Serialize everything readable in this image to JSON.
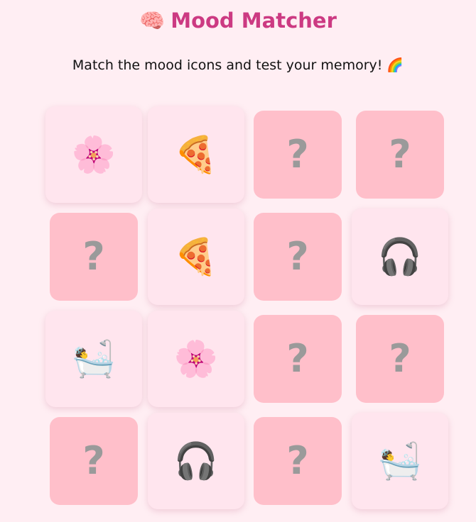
{
  "header": {
    "title_emoji": "🧠",
    "title": "Mood Matcher",
    "subtitle": "Match the mood icons and test your memory!",
    "subtitle_emoji": "🌈"
  },
  "colors": {
    "background": "#ffeef3",
    "title": "#cc3a82",
    "card_back": "#ffbfca",
    "card_front": "#ffe5ee",
    "question_mark": "#9a9a9a"
  },
  "board": {
    "hidden_symbol": "?",
    "cards": [
      {
        "state": "revealed",
        "icon": "cherry-blossom-icon",
        "emoji": "🌸"
      },
      {
        "state": "revealed",
        "icon": "pizza-icon",
        "emoji": "🍕"
      },
      {
        "state": "hidden",
        "icon": "question-icon",
        "emoji": ""
      },
      {
        "state": "hidden",
        "icon": "question-icon",
        "emoji": ""
      },
      {
        "state": "hidden",
        "icon": "question-icon",
        "emoji": ""
      },
      {
        "state": "revealed",
        "icon": "pizza-icon",
        "emoji": "🍕"
      },
      {
        "state": "hidden",
        "icon": "question-icon",
        "emoji": ""
      },
      {
        "state": "revealed",
        "icon": "headphones-icon",
        "emoji": "🎧"
      },
      {
        "state": "revealed",
        "icon": "bath-icon",
        "emoji": "🛀"
      },
      {
        "state": "revealed",
        "icon": "cherry-blossom-icon",
        "emoji": "🌸"
      },
      {
        "state": "hidden",
        "icon": "question-icon",
        "emoji": ""
      },
      {
        "state": "hidden",
        "icon": "question-icon",
        "emoji": ""
      },
      {
        "state": "hidden",
        "icon": "question-icon",
        "emoji": ""
      },
      {
        "state": "revealed",
        "icon": "headphones-icon",
        "emoji": "🎧"
      },
      {
        "state": "hidden",
        "icon": "question-icon",
        "emoji": ""
      },
      {
        "state": "revealed",
        "icon": "bath-icon",
        "emoji": "🛀"
      }
    ]
  }
}
